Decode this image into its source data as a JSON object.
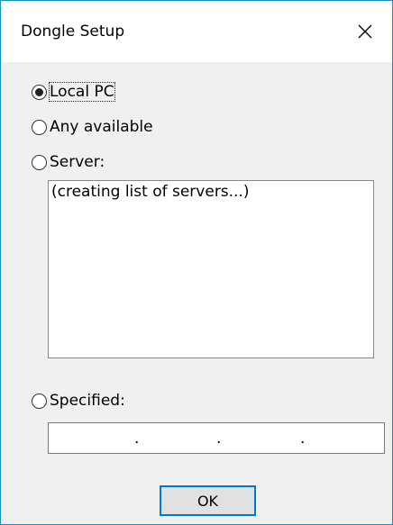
{
  "window": {
    "title": "Dongle Setup",
    "accent_color": "#1a8fc4",
    "close_icon": "close-icon"
  },
  "options": {
    "local_pc": {
      "label": "Local PC",
      "checked": true
    },
    "any_available": {
      "label": "Any available",
      "checked": false
    },
    "server": {
      "label": "Server:",
      "checked": false
    },
    "specified": {
      "label": "Specified:",
      "checked": false
    }
  },
  "server_list": {
    "items": [
      "(creating list of servers...)"
    ]
  },
  "ip_address": {
    "separator": "."
  },
  "buttons": {
    "ok_label": "OK"
  }
}
